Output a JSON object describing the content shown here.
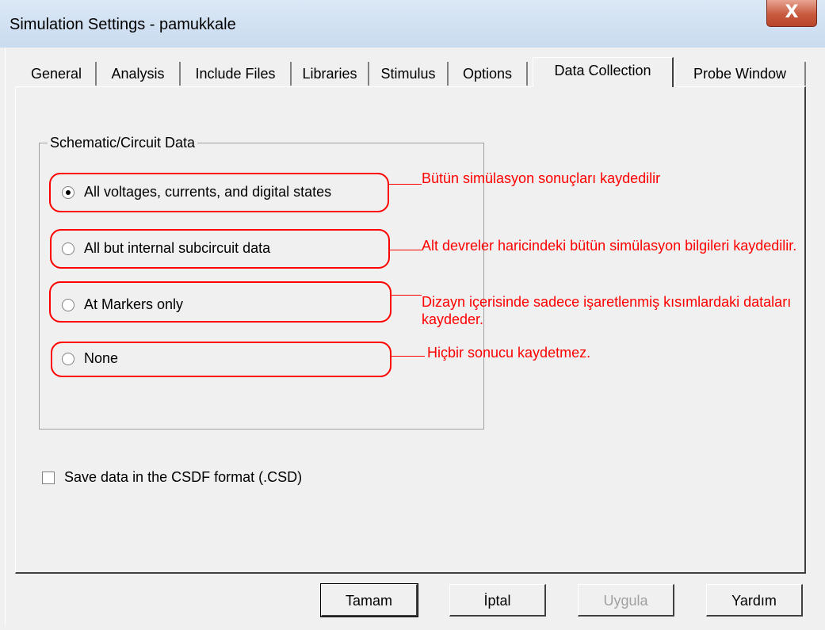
{
  "window": {
    "title": "Simulation Settings - pamukkale",
    "close_glyph": "X"
  },
  "tabs": [
    {
      "label": "General"
    },
    {
      "label": "Analysis"
    },
    {
      "label": "Include Files"
    },
    {
      "label": "Libraries"
    },
    {
      "label": "Stimulus"
    },
    {
      "label": "Options"
    },
    {
      "label": "Data Collection",
      "selected": true
    },
    {
      "label": "Probe Window"
    }
  ],
  "group": {
    "label": "Schematic/Circuit Data",
    "options": [
      {
        "label": "All voltages, currents, and digital states",
        "selected": true
      },
      {
        "label": "All but internal subcircuit data",
        "selected": false
      },
      {
        "label": "At Markers only",
        "selected": false
      },
      {
        "label": "None",
        "selected": false
      }
    ]
  },
  "annotations": [
    {
      "text": "Bütün simülasyon sonuçları kaydedilir"
    },
    {
      "text": "Alt devreler haricindeki bütün simülasyon bilgileri kaydedilir."
    },
    {
      "text": "Dizayn içerisinde sadece işaretlenmiş kısımlardaki dataları kaydeder."
    },
    {
      "text": "Hiçbir sonucu kaydetmez."
    }
  ],
  "annotation_color": "#ff0000",
  "checkbox": {
    "label": "Save data in the CSDF format (.CSD)",
    "checked": false
  },
  "buttons": {
    "ok": "Tamam",
    "cancel": "İptal",
    "apply": "Uygula",
    "help": "Yardım"
  }
}
